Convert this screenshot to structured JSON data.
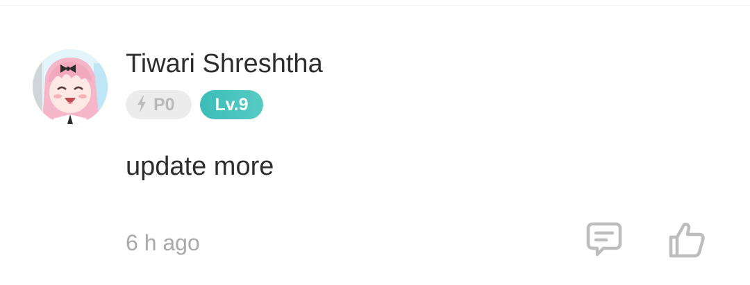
{
  "comment": {
    "author": {
      "name": "Tiwari Shreshtha",
      "avatar_icon": "anime-girl-avatar"
    },
    "badges": {
      "points_label": "P0",
      "points_icon": "lightning-bolt-icon",
      "level_label": "Lv.9"
    },
    "text": "update more",
    "timestamp": "6 h ago",
    "actions": {
      "reply_icon": "comment-icon",
      "like_icon": "thumbs-up-icon"
    }
  },
  "colors": {
    "text_primary": "#2d2d2d",
    "text_secondary": "#a9a9a9",
    "level_badge": "#46c2bd",
    "points_badge_bg": "#ececec",
    "icon_gray": "#bdbdbd"
  }
}
